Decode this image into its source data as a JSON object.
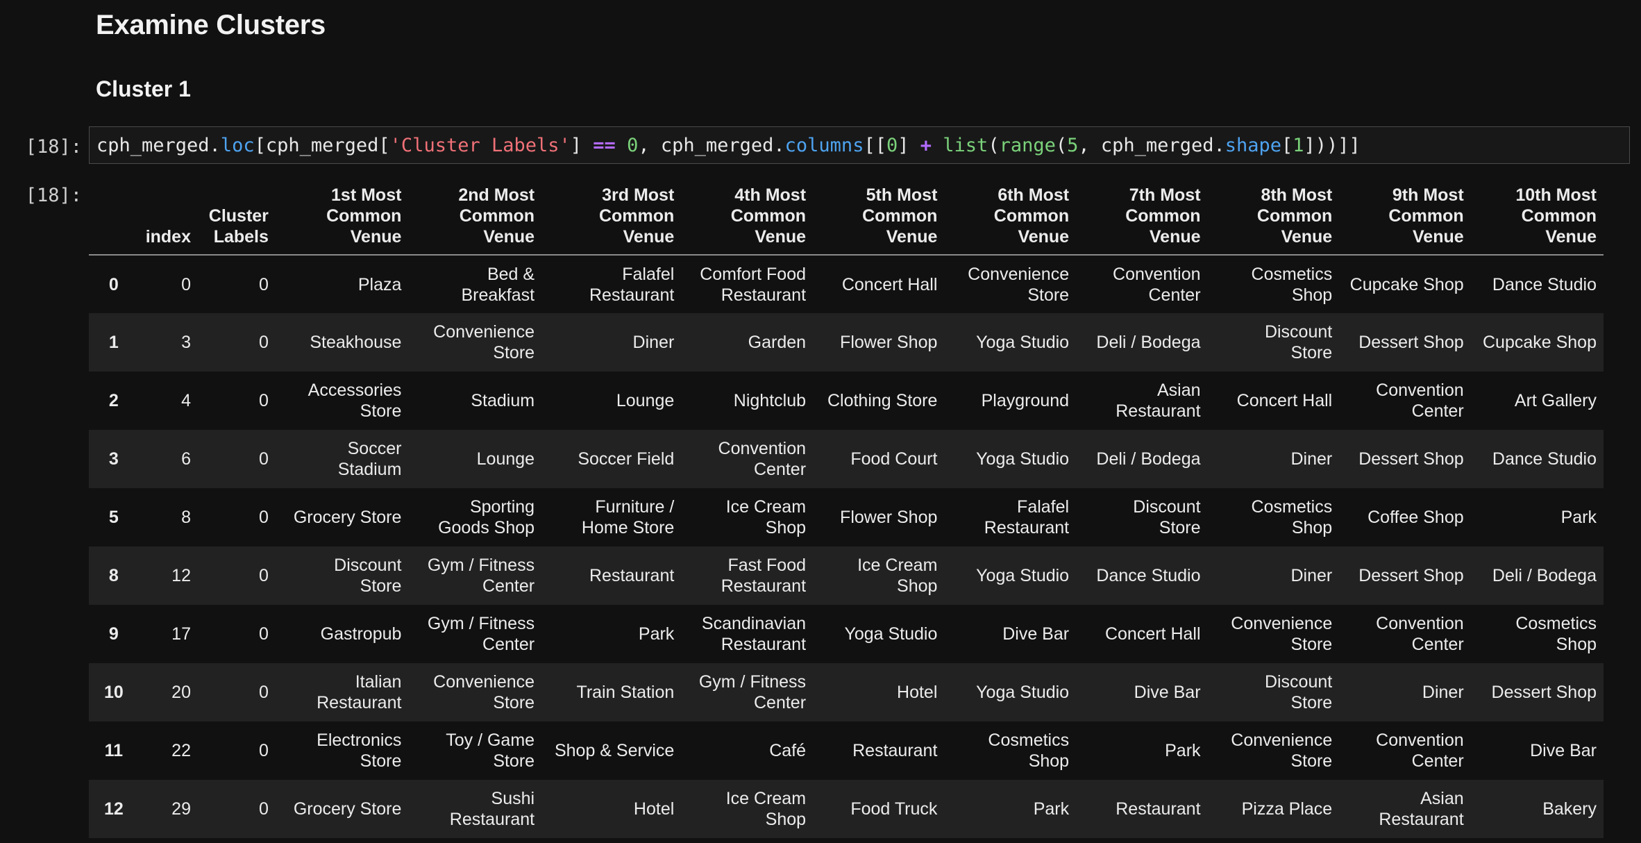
{
  "headings": {
    "section_title": "Examine Clusters",
    "subsection_title": "Cluster 1"
  },
  "cell": {
    "in_prompt": "[18]:",
    "out_prompt": "[18]:",
    "code_tokens": [
      {
        "t": "cph_merged.",
        "k": "plain"
      },
      {
        "t": "loc",
        "k": "attr"
      },
      {
        "t": "[cph_merged[",
        "k": "plain"
      },
      {
        "t": "'Cluster Labels'",
        "k": "str"
      },
      {
        "t": "] ",
        "k": "plain"
      },
      {
        "t": "==",
        "k": "op"
      },
      {
        "t": " ",
        "k": "plain"
      },
      {
        "t": "0",
        "k": "num"
      },
      {
        "t": ", cph_merged.",
        "k": "plain"
      },
      {
        "t": "columns",
        "k": "attr"
      },
      {
        "t": "[[",
        "k": "plain"
      },
      {
        "t": "0",
        "k": "num"
      },
      {
        "t": "] ",
        "k": "plain"
      },
      {
        "t": "+",
        "k": "op"
      },
      {
        "t": " ",
        "k": "plain"
      },
      {
        "t": "list",
        "k": "builtin"
      },
      {
        "t": "(",
        "k": "plain"
      },
      {
        "t": "range",
        "k": "builtin"
      },
      {
        "t": "(",
        "k": "plain"
      },
      {
        "t": "5",
        "k": "num"
      },
      {
        "t": ", cph_merged.",
        "k": "plain"
      },
      {
        "t": "shape",
        "k": "attr"
      },
      {
        "t": "[",
        "k": "plain"
      },
      {
        "t": "1",
        "k": "num"
      },
      {
        "t": "]))]]",
        "k": "plain"
      }
    ]
  },
  "table": {
    "headers": [
      "",
      "index",
      "Cluster\nLabels",
      "1st Most\nCommon\nVenue",
      "2nd Most\nCommon\nVenue",
      "3rd Most\nCommon\nVenue",
      "4th Most\nCommon\nVenue",
      "5th Most\nCommon\nVenue",
      "6th Most\nCommon\nVenue",
      "7th Most\nCommon\nVenue",
      "8th Most\nCommon\nVenue",
      "9th Most\nCommon\nVenue",
      "10th Most\nCommon\nVenue"
    ],
    "rows": [
      {
        "idx": "0",
        "cells": [
          "0",
          "0",
          "Plaza",
          "Bed &\nBreakfast",
          "Falafel\nRestaurant",
          "Comfort Food\nRestaurant",
          "Concert Hall",
          "Convenience\nStore",
          "Convention\nCenter",
          "Cosmetics\nShop",
          "Cupcake Shop",
          "Dance Studio"
        ]
      },
      {
        "idx": "1",
        "cells": [
          "3",
          "0",
          "Steakhouse",
          "Convenience\nStore",
          "Diner",
          "Garden",
          "Flower Shop",
          "Yoga Studio",
          "Deli / Bodega",
          "Discount\nStore",
          "Dessert Shop",
          "Cupcake Shop"
        ]
      },
      {
        "idx": "2",
        "cells": [
          "4",
          "0",
          "Accessories\nStore",
          "Stadium",
          "Lounge",
          "Nightclub",
          "Clothing Store",
          "Playground",
          "Asian\nRestaurant",
          "Concert Hall",
          "Convention\nCenter",
          "Art Gallery"
        ]
      },
      {
        "idx": "3",
        "cells": [
          "6",
          "0",
          "Soccer\nStadium",
          "Lounge",
          "Soccer Field",
          "Convention\nCenter",
          "Food Court",
          "Yoga Studio",
          "Deli / Bodega",
          "Diner",
          "Dessert Shop",
          "Dance Studio"
        ]
      },
      {
        "idx": "5",
        "cells": [
          "8",
          "0",
          "Grocery Store",
          "Sporting\nGoods Shop",
          "Furniture /\nHome Store",
          "Ice Cream\nShop",
          "Flower Shop",
          "Falafel\nRestaurant",
          "Discount\nStore",
          "Cosmetics\nShop",
          "Coffee Shop",
          "Park"
        ]
      },
      {
        "idx": "8",
        "cells": [
          "12",
          "0",
          "Discount\nStore",
          "Gym / Fitness\nCenter",
          "Restaurant",
          "Fast Food\nRestaurant",
          "Ice Cream\nShop",
          "Yoga Studio",
          "Dance Studio",
          "Diner",
          "Dessert Shop",
          "Deli / Bodega"
        ]
      },
      {
        "idx": "9",
        "cells": [
          "17",
          "0",
          "Gastropub",
          "Gym / Fitness\nCenter",
          "Park",
          "Scandinavian\nRestaurant",
          "Yoga Studio",
          "Dive Bar",
          "Concert Hall",
          "Convenience\nStore",
          "Convention\nCenter",
          "Cosmetics\nShop"
        ]
      },
      {
        "idx": "10",
        "cells": [
          "20",
          "0",
          "Italian\nRestaurant",
          "Convenience\nStore",
          "Train Station",
          "Gym / Fitness\nCenter",
          "Hotel",
          "Yoga Studio",
          "Dive Bar",
          "Discount\nStore",
          "Diner",
          "Dessert Shop"
        ]
      },
      {
        "idx": "11",
        "cells": [
          "22",
          "0",
          "Electronics\nStore",
          "Toy / Game\nStore",
          "Shop & Service",
          "Café",
          "Restaurant",
          "Cosmetics\nShop",
          "Park",
          "Convenience\nStore",
          "Convention\nCenter",
          "Dive Bar"
        ]
      },
      {
        "idx": "12",
        "cells": [
          "29",
          "0",
          "Grocery Store",
          "Sushi\nRestaurant",
          "Hotel",
          "Ice Cream\nShop",
          "Food Truck",
          "Park",
          "Restaurant",
          "Pizza Place",
          "Asian\nRestaurant",
          "Bakery"
        ]
      }
    ]
  }
}
